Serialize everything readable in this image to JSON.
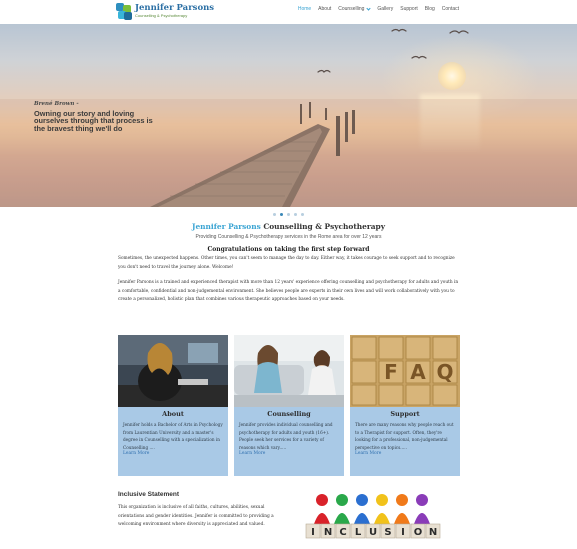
{
  "logo": {
    "name": "Jennifer Parsons",
    "tagline": "Counselling & Psychotherapy"
  },
  "nav": {
    "items": [
      {
        "label": "Home",
        "active": true
      },
      {
        "label": "About"
      },
      {
        "label": "Counselling",
        "dropdown": true
      },
      {
        "label": "Gallery"
      },
      {
        "label": "Support"
      },
      {
        "label": "Blog"
      },
      {
        "label": "Contact"
      }
    ]
  },
  "hero": {
    "quote_author": "Brené Brown -",
    "quote_text": "Owning our story and loving ourselves through that process is the bravest thing we'll do",
    "slides": 5,
    "active_slide": 2
  },
  "intro": {
    "title_brand": "Jennifer Parsons",
    "title_rest": " Counselling & Psychotherapy",
    "subtitle": "Providing Counselling & Psychotherapy services in the Rome area for over 12 years",
    "heading": "Congratulations on taking the first step forward",
    "paragraph1": "Sometimes, the unexpected happens. Other times, you can't seem to manage the day to day. Either way, it takes courage to seek support and to recognize you don't need to travel the journey alone. Welcome!",
    "paragraph2": "Jennifer Parsons is a trained and experienced therapist with more than 12 years' experience offering counselling and psychotherapy for adults and youth in a comfortable, confidential and non-judgemental environment. She believes people are experts in their own lives and will work collaboratively with you to create a personalized, holistic plan that combines various therapeutic approaches based on your needs."
  },
  "cards": [
    {
      "title": "About",
      "body": "Jennifer holds a Bachelor of Arts in Psychology from Laurentian University and a master's degree in Counselling with a specialization in Counselling ....",
      "link": "Learn More"
    },
    {
      "title": "Counselling",
      "body": "Jennifer provides individual counselling and psychotherapy for adults and youth (16+). People seek her services for a variety of reasons which vary.....",
      "link": "Learn More"
    },
    {
      "title": "Support",
      "body": "There are many reasons why people reach out to a Therapist for support. Often, they're looking for a professional, non-judgemental perspective on topics.....",
      "link": "Learn More"
    }
  ],
  "inclusive": {
    "title": "Inclusive Statement",
    "text": "This organization is inclusive of all faiths, cultures, abilities, sexual orientations and gender identities. Jennifer is committed to providing a welcoming environment where diversity is appreciated and valued.",
    "image_letters": [
      "I",
      "N",
      "C",
      "L",
      "U",
      "S",
      "I",
      "O",
      "N"
    ]
  },
  "colors": {
    "accent": "#3aa4d3",
    "card_bg": "#a9c9e6",
    "link": "#2f6fae"
  }
}
